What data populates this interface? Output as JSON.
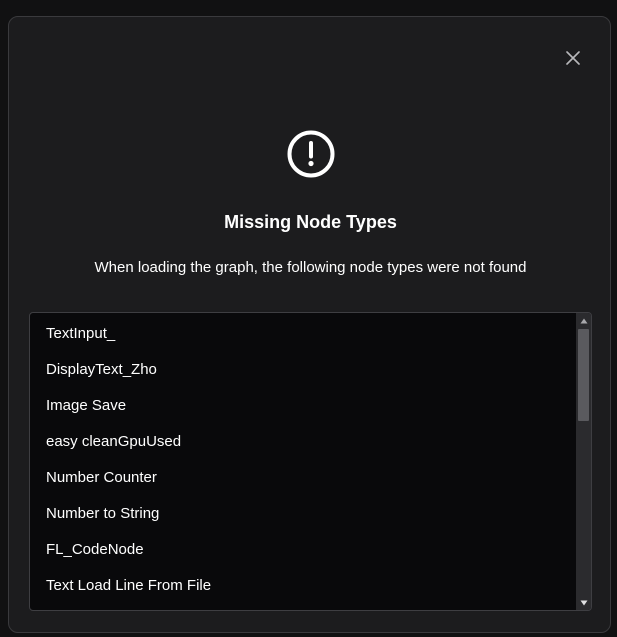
{
  "dialog": {
    "title": "Missing Node Types",
    "message": "When loading the graph, the following node types were not found",
    "close_icon": "close-icon",
    "warning_icon": "exclamation-circle-icon"
  },
  "missing_nodes": [
    "TextInput_",
    "DisplayText_Zho",
    "Image Save",
    "easy cleanGpuUsed",
    "Number Counter",
    "Number to String",
    "FL_CodeNode",
    "Text Load Line From File"
  ],
  "colors": {
    "background": "#111112",
    "dialog": "#1c1c1e",
    "list_background": "#09090b",
    "text": "#ffffff",
    "scroll_thumb": "#5a5a5e"
  }
}
